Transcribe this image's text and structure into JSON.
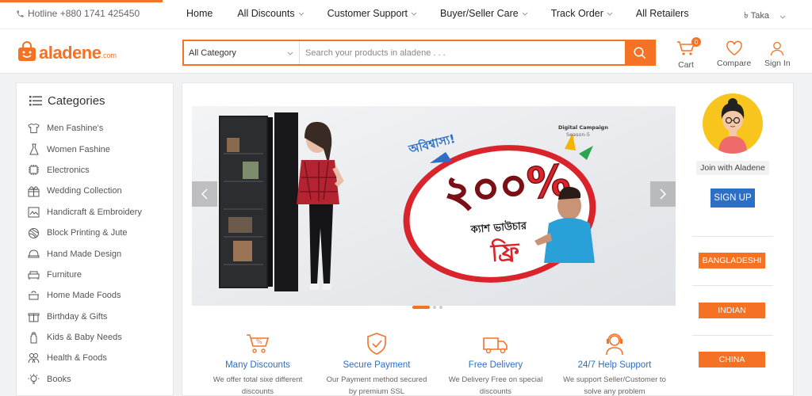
{
  "topbar": {
    "hotline": "Hotline +880 1741 425450",
    "nav": [
      {
        "label": "Home",
        "dropdown": false
      },
      {
        "label": "All Discounts",
        "dropdown": true
      },
      {
        "label": "Customer Support",
        "dropdown": true
      },
      {
        "label": "Buyer/Seller Care",
        "dropdown": true
      },
      {
        "label": "Track Order",
        "dropdown": true
      },
      {
        "label": "All Retailers",
        "dropdown": false
      }
    ],
    "currency": "৳ Taka"
  },
  "header": {
    "logo_text": "aladene",
    "logo_suffix": ".com",
    "search": {
      "category": "All Category",
      "placeholder": "Search your products in aladene . . ."
    },
    "cart_label": "Cart",
    "cart_count": "0",
    "compare_label": "Compare",
    "signin_label": "Sign In"
  },
  "categories": {
    "title": "Categories",
    "items": [
      {
        "label": "Men Fashine's",
        "icon": "shirt-icon"
      },
      {
        "label": "Women Fashine",
        "icon": "dress-icon"
      },
      {
        "label": "Electronics",
        "icon": "chip-icon"
      },
      {
        "label": "Wedding Collection",
        "icon": "gift-icon"
      },
      {
        "label": "Handicraft & Embroidery",
        "icon": "frame-icon"
      },
      {
        "label": "Block Printing & Jute",
        "icon": "yarn-icon"
      },
      {
        "label": "Hand Made Design",
        "icon": "hat-icon"
      },
      {
        "label": "Furniture",
        "icon": "sofa-icon"
      },
      {
        "label": "Home Made Foods",
        "icon": "pot-icon"
      },
      {
        "label": "Birthday & Gifts",
        "icon": "present-icon"
      },
      {
        "label": "Kids & Baby Needs",
        "icon": "bottle-icon"
      },
      {
        "label": "Health & Foods",
        "icon": "health-icon"
      },
      {
        "label": "Books",
        "icon": "bulb-icon"
      }
    ]
  },
  "banner": {
    "lines": [
      "অবিশ্বাস্য!",
      "২০০%",
      "ক্যাশ ভাউচার",
      "ফ্রি",
      "Digital Campaign",
      "Season-5"
    ],
    "slides_total": 3,
    "active_slide": 1
  },
  "features": [
    {
      "title": "Many Discounts",
      "desc": "We offer total sixe different discounts",
      "icon": "discount-icon"
    },
    {
      "title": "Secure Payment",
      "desc": "Our Payment method secured by premium SSL",
      "icon": "shield-icon"
    },
    {
      "title": "Free Delivery",
      "desc": "We Delivery Free on special discounts",
      "icon": "truck-icon"
    },
    {
      "title": "24/7 Help Support",
      "desc": "We support Seller/Customer to solve any problem",
      "icon": "support-icon"
    }
  ],
  "sidebar": {
    "join_text": "Join with Aladene",
    "signup_label": "SIGN UP",
    "countries": [
      "BANGLADESHI",
      "INDIAN",
      "CHINA"
    ]
  },
  "colors": {
    "accent": "#f57224",
    "link": "#2d6fc4"
  }
}
